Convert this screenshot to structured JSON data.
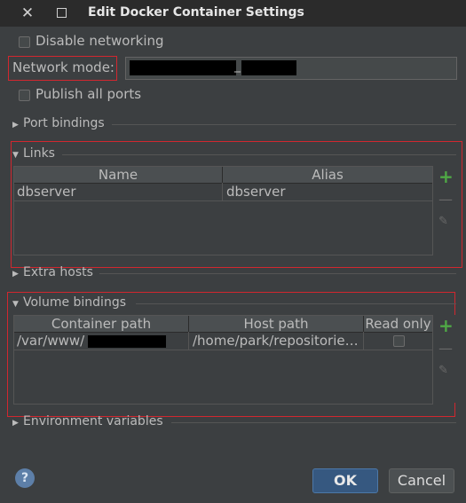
{
  "window": {
    "title": "Edit Docker Container Settings",
    "close_glyph": "✕"
  },
  "settings": {
    "disable_networking_label": "Disable networking",
    "network_mode_label": "Network mode:",
    "network_mode_value_visible": "_",
    "publish_all_ports_label": "Publish all ports"
  },
  "sections": {
    "port_bindings": "Port bindings",
    "links": "Links",
    "extra_hosts": "Extra hosts",
    "volume_bindings": "Volume bindings",
    "environment_variables": "Environment variables"
  },
  "links_table": {
    "columns": [
      "Name",
      "Alias"
    ],
    "rows": [
      {
        "name": "dbserver",
        "alias": "dbserver"
      }
    ]
  },
  "volume_table": {
    "columns": [
      "Container path",
      "Host path",
      "Read only"
    ],
    "rows": [
      {
        "container_path": "/var/www/",
        "host_path": "/home/park/repositorie…",
        "read_only": false
      }
    ]
  },
  "toolbar_icons": {
    "add": "+",
    "remove": "—",
    "edit": "✎"
  },
  "buttons": {
    "help": "?",
    "ok": "OK",
    "cancel": "Cancel"
  },
  "colors": {
    "background": "#3c3f41",
    "highlight_border": "#d1272f",
    "add_icon": "#4fa845",
    "ok_button": "#365880"
  }
}
